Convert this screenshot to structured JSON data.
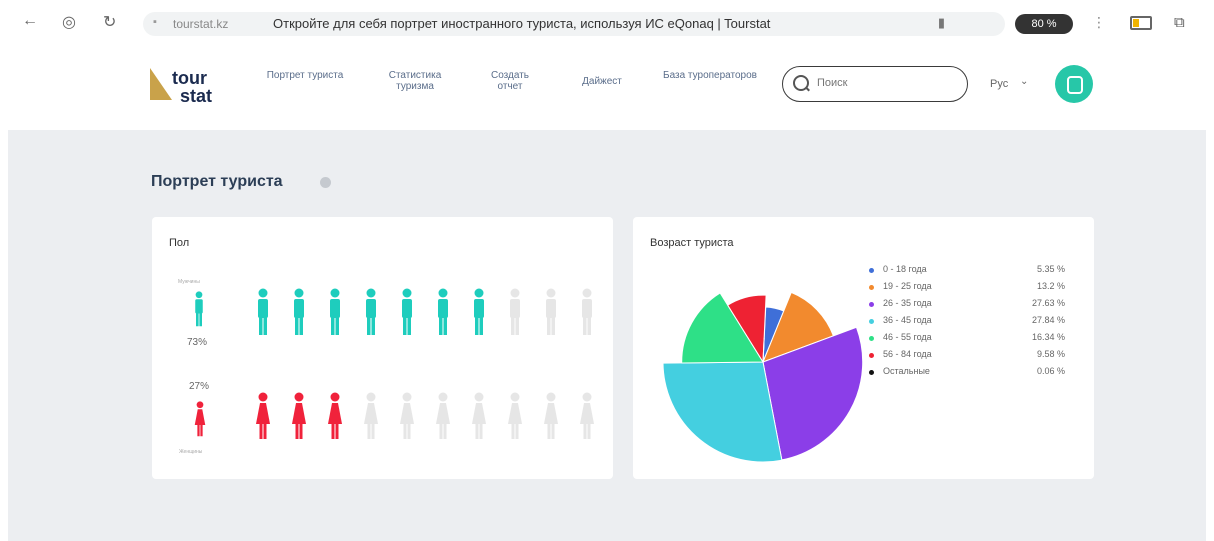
{
  "browser": {
    "url_domain": "tourstat.kz",
    "tab_title": "Откройте для себя портрет иностранного туриста, используя ИС eQonaq | Tourstat",
    "zoom": "80 %"
  },
  "header": {
    "logo_line1": "tour",
    "logo_line2": "stat",
    "nav": [
      {
        "label": "Портрет туриста"
      },
      {
        "label": "Статистика туризма"
      },
      {
        "label": "Создать отчет"
      },
      {
        "label": "Дайжест"
      },
      {
        "label": "База туроператоров"
      }
    ],
    "search_placeholder": "Поиск",
    "language": "Рус"
  },
  "page": {
    "title": "Портрет туриста"
  },
  "gender_card": {
    "title": "Пол",
    "male": {
      "label": "Мужчины",
      "percent": "73%",
      "share": 0.73,
      "icons_total": 10,
      "icons_filled": 7,
      "color": "#1ecdbd"
    },
    "female": {
      "label": "Женщины",
      "percent": "27%",
      "share": 0.27,
      "icons_total": 10,
      "icons_filled": 3,
      "color": "#f0223b"
    },
    "inactive_color": "#e6e6e6"
  },
  "age_card": {
    "title": "Возраст туриста",
    "legend": [
      {
        "label": "0 - 18 года",
        "value": "5.35 %",
        "color": "#3f6fd8"
      },
      {
        "label": "19 - 25 года",
        "value": "13.2 %",
        "color": "#f28a2e"
      },
      {
        "label": "26 - 35 года",
        "value": "27.63 %",
        "color": "#8b3ee8"
      },
      {
        "label": "36 - 45 года",
        "value": "27.84 %",
        "color": "#44cfe0"
      },
      {
        "label": "46 - 55 года",
        "value": "16.34 %",
        "color": "#2ee087"
      },
      {
        "label": "56 - 84 года",
        "value": "9.58 %",
        "color": "#ee2233"
      },
      {
        "label": "Остальные",
        "value": "0.06 %",
        "color": "#111111"
      }
    ]
  },
  "chart_data": {
    "type": "pie",
    "title": "Возраст туриста",
    "categories": [
      "0 - 18 года",
      "19 - 25 года",
      "26 - 35 года",
      "36 - 45 года",
      "46 - 55 года",
      "56 - 84 года",
      "Остальные"
    ],
    "values": [
      5.35,
      13.2,
      27.63,
      27.84,
      16.34,
      9.58,
      0.06
    ],
    "legend": "right"
  }
}
